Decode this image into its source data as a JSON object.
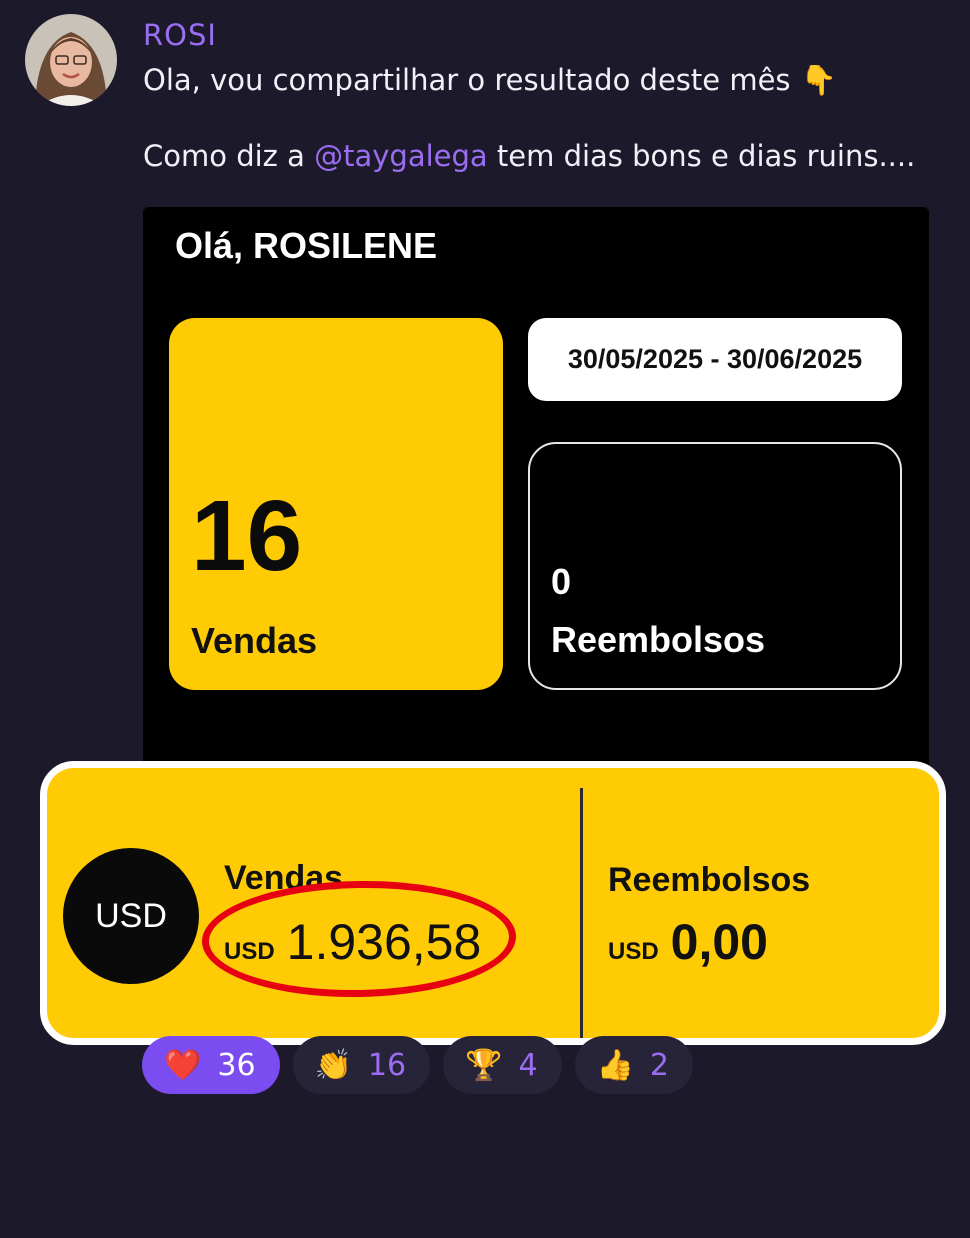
{
  "post": {
    "author": "ROSI",
    "line1": "Ola, vou compartilhar o resultado deste mês",
    "line1_emoji": "👇",
    "line2_before": "Como diz a ",
    "line2_mention": "@taygalega",
    "line2_after": " tem dias bons e dias ruins...."
  },
  "dashboard": {
    "greeting": "Olá, ROSILENE",
    "sales_count": "16",
    "sales_label": "Vendas",
    "date_range": "30/05/2025 - 30/06/2025",
    "refunds_count": "0",
    "refunds_label": "Reembolsos"
  },
  "summary": {
    "currency_badge": "USD",
    "sales_label": "Vendas",
    "sales_currency": "USD",
    "sales_amount": "1.936,58",
    "refunds_label": "Reembolsos",
    "refunds_currency": "USD",
    "refunds_amount": "0,00"
  },
  "reactions": [
    {
      "emoji": "❤️",
      "icon": "heart-icon",
      "count": "36",
      "active": true
    },
    {
      "emoji": "👏",
      "icon": "clap-icon",
      "count": "16",
      "active": false
    },
    {
      "emoji": "🏆",
      "icon": "trophy-icon",
      "count": "4",
      "active": false
    },
    {
      "emoji": "👍",
      "icon": "thumbs-up-icon",
      "count": "2",
      "active": false
    }
  ],
  "colors": {
    "background": "#1c1a2a",
    "accent_purple": "#9b6df2",
    "card_yellow": "#ffcb05",
    "highlight_red": "#e60012"
  }
}
